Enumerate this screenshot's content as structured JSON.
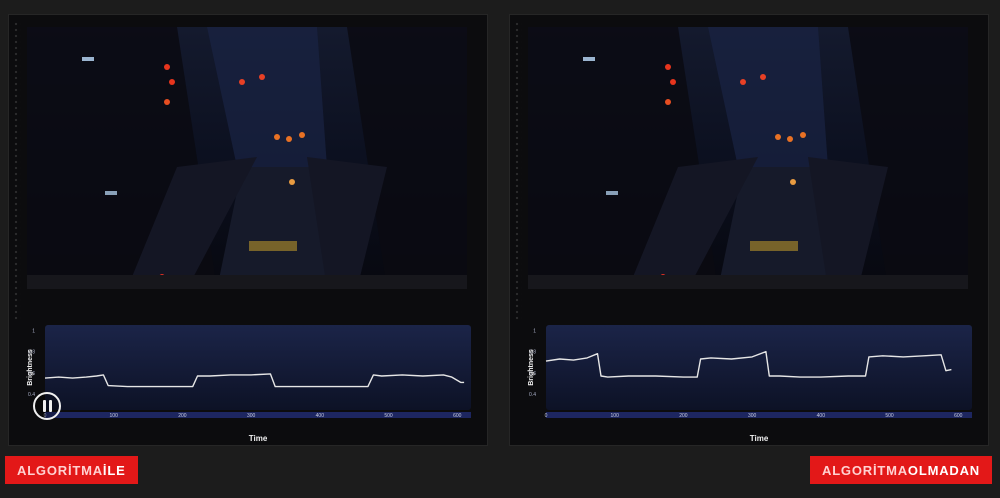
{
  "colors": {
    "tag_background": "#e31818",
    "plot_top": "#1b2448",
    "plot_bottom": "#0d1226",
    "plot_line": "#e6e6e6",
    "time_bar": "#1d2660"
  },
  "icons": {
    "pause": "pause-icon"
  },
  "left_tag": {
    "part1": "ALGORİTMA",
    "part2": "İLE"
  },
  "right_tag": {
    "part1": "ALGORİTMA",
    "part2": "OLMADAN"
  },
  "chart_data": [
    {
      "type": "line",
      "xlabel": "Time",
      "ylabel": "Brightness",
      "xlim": [
        0,
        620
      ],
      "ylim": [
        0.25,
        1.05
      ],
      "xticks": [
        0,
        100,
        200,
        300,
        400,
        500,
        600
      ],
      "yticks": [
        0.4,
        0.6,
        0.8,
        1
      ],
      "ytick_labels": [
        "0.4",
        "0.6",
        "0.8",
        "1"
      ],
      "x": [
        0,
        20,
        40,
        60,
        75,
        85,
        92,
        120,
        160,
        190,
        215,
        222,
        240,
        270,
        300,
        328,
        335,
        360,
        400,
        440,
        470,
        478,
        490,
        520,
        550,
        580,
        592,
        605,
        610
      ],
      "y": [
        0.55,
        0.56,
        0.55,
        0.56,
        0.57,
        0.58,
        0.48,
        0.47,
        0.47,
        0.47,
        0.47,
        0.57,
        0.57,
        0.58,
        0.58,
        0.59,
        0.47,
        0.47,
        0.47,
        0.47,
        0.47,
        0.58,
        0.57,
        0.58,
        0.57,
        0.58,
        0.56,
        0.51,
        0.51
      ]
    },
    {
      "type": "line",
      "xlabel": "Time",
      "ylabel": "Brightness",
      "xlim": [
        0,
        620
      ],
      "ylim": [
        0.25,
        1.05
      ],
      "xticks": [
        0,
        100,
        200,
        300,
        400,
        500,
        600
      ],
      "yticks": [
        0.4,
        0.6,
        0.8,
        1
      ],
      "ytick_labels": [
        "0.4",
        "0.6",
        "0.8",
        "1"
      ],
      "x": [
        0,
        20,
        40,
        60,
        75,
        80,
        90,
        120,
        160,
        200,
        220,
        225,
        240,
        270,
        300,
        320,
        325,
        340,
        370,
        400,
        440,
        465,
        470,
        490,
        520,
        550,
        575,
        582,
        590
      ],
      "y": [
        0.71,
        0.73,
        0.72,
        0.74,
        0.78,
        0.57,
        0.56,
        0.57,
        0.57,
        0.56,
        0.56,
        0.73,
        0.74,
        0.73,
        0.75,
        0.8,
        0.57,
        0.57,
        0.56,
        0.56,
        0.57,
        0.57,
        0.75,
        0.76,
        0.75,
        0.76,
        0.77,
        0.62,
        0.63
      ]
    }
  ]
}
